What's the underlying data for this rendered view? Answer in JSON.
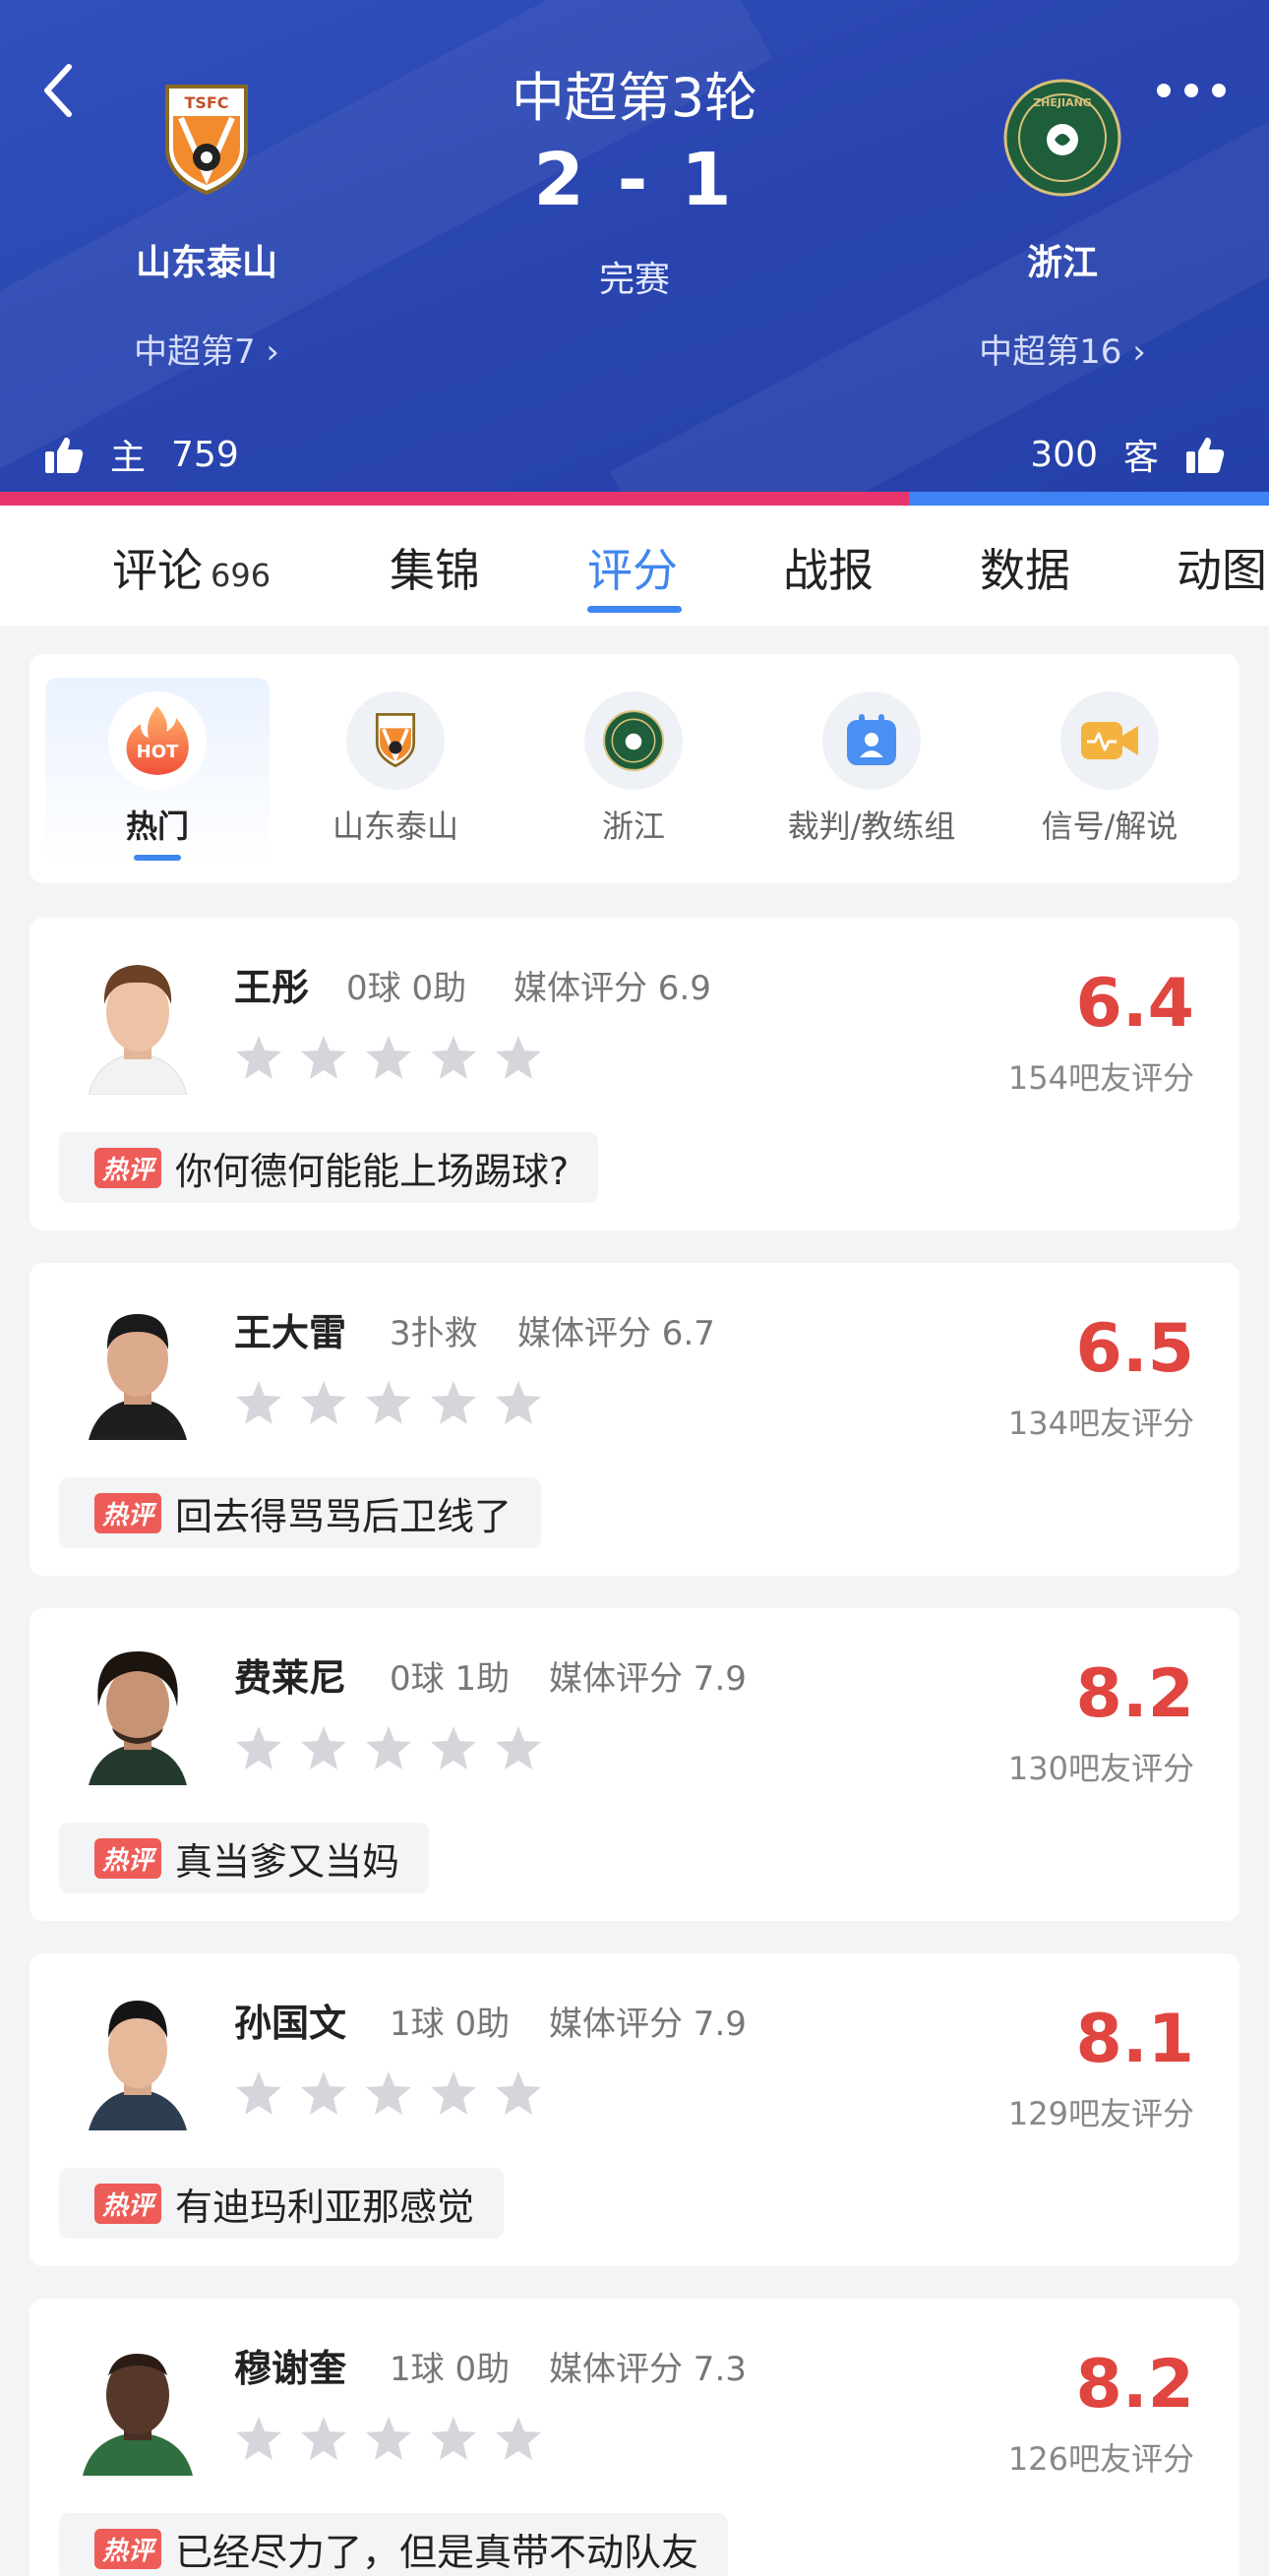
{
  "header": {
    "round": "中超第3轮",
    "score": "2 - 1",
    "status": "完赛",
    "home": {
      "name": "山东泰山",
      "rank": "中超第7",
      "logo_text": "TSFC",
      "likes_label": "主",
      "likes": "759"
    },
    "away": {
      "name": "浙江",
      "rank": "中超第16",
      "logo_text": "ZHEJIANG",
      "likes_label": "客",
      "likes": "300"
    },
    "like_ratio_home": 0.716,
    "colors": {
      "home_bar": "#e8346c",
      "away_bar": "#3f83f5",
      "header_bg": "#2a45b0"
    }
  },
  "tabs": [
    {
      "label": "评论",
      "count": "696"
    },
    {
      "label": "集锦"
    },
    {
      "label": "评分",
      "active": true
    },
    {
      "label": "战报"
    },
    {
      "label": "数据"
    },
    {
      "label": "动图"
    }
  ],
  "filters": [
    {
      "label": "热门",
      "icon": "hot-icon",
      "icon_text": "HOT",
      "active": true
    },
    {
      "label": "山东泰山",
      "icon": "shandong-taishan-logo-icon"
    },
    {
      "label": "浙江",
      "icon": "zhejiang-logo-icon"
    },
    {
      "label": "裁判/教练组",
      "icon": "referee-badge-icon"
    },
    {
      "label": "信号/解说",
      "icon": "video-signal-icon"
    }
  ],
  "hot_tag": "热评",
  "players": [
    {
      "name": "王彤",
      "stats": "0球 0助",
      "media": "媒体评分 6.9",
      "score": "6.4",
      "votes": "154吧友评分",
      "hot_comment": "你何德何能能上场踢球?"
    },
    {
      "name": "王大雷",
      "stats": "3扑救",
      "media": "媒体评分 6.7",
      "score": "6.5",
      "votes": "134吧友评分",
      "hot_comment": "回去得骂骂后卫线了"
    },
    {
      "name": "费莱尼",
      "stats": "0球 1助",
      "media": "媒体评分 7.9",
      "score": "8.2",
      "votes": "130吧友评分",
      "hot_comment": "真当爹又当妈"
    },
    {
      "name": "孙国文",
      "stats": "1球 0助",
      "media": "媒体评分 7.9",
      "score": "8.1",
      "votes": "129吧友评分",
      "hot_comment": "有迪玛利亚那感觉"
    },
    {
      "name": "穆谢奎",
      "stats": "1球 0助",
      "media": "媒体评分 7.3",
      "score": "8.2",
      "votes": "126吧友评分",
      "hot_comment": "已经尽力了，但是真带不动队友"
    }
  ]
}
